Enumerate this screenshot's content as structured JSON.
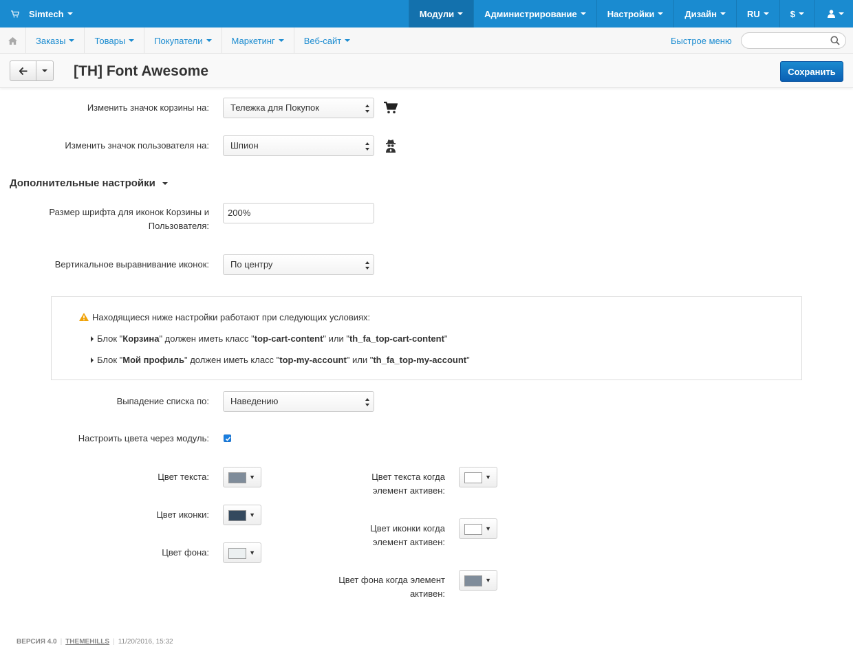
{
  "topbar": {
    "brand": "Simtech",
    "menu": [
      {
        "label": "Модули",
        "active": true
      },
      {
        "label": "Администрирование"
      },
      {
        "label": "Настройки"
      },
      {
        "label": "Дизайн"
      },
      {
        "label": "RU"
      },
      {
        "label": "$"
      },
      {
        "label": ""
      }
    ]
  },
  "subnav": {
    "tabs": [
      "Заказы",
      "Товары",
      "Покупатели",
      "Маркетинг",
      "Веб-сайт"
    ],
    "quick_menu": "Быстрое меню",
    "search_placeholder": ""
  },
  "titlebar": {
    "title": "[TH] Font Awesome",
    "save_label": "Сохранить"
  },
  "form": {
    "cart_icon": {
      "label": "Изменить значок корзины на:",
      "value": "Тележка для Покупок",
      "preview_icon": "shopping-cart-icon"
    },
    "user_icon": {
      "label": "Изменить значок пользователя на:",
      "value": "Шпион",
      "preview_icon": "user-secret-icon"
    },
    "section_title": "Дополнительные настройки",
    "font_size": {
      "label_line1": "Размер шрифта для иконок Корзины и",
      "label_line2": "Пользователя:",
      "value": "200%"
    },
    "vertical_align": {
      "label": "Вертикальное выравнивание иконок:",
      "value": "По центру"
    },
    "notice": {
      "intro": "Находящиеся ниже настройки работают при следующих условиях:",
      "line1": {
        "pre": "Блок \"",
        "block": "Корзина",
        "mid": "\" должен иметь класс \"",
        "cls1": "top-cart-content",
        "or": "\" или \"",
        "cls2": "th_fa_top-cart-content",
        "end": "\""
      },
      "line2": {
        "pre": "Блок \"",
        "block": "Мой профиль",
        "mid": "\" должен иметь класс \"",
        "cls1": "top-my-account",
        "or": "\" или \"",
        "cls2": "th_fa_top-my-account",
        "end": "\""
      }
    },
    "dropdown_on": {
      "label": "Выпадение списка по:",
      "value": "Наведению"
    },
    "colors_via_module": {
      "label": "Настроить цвета через модуль:",
      "checked": true
    },
    "colors": {
      "text": {
        "label": "Цвет текста:",
        "color": "#7f8c9a"
      },
      "icon": {
        "label": "Цвет иконки:",
        "color": "#34495e"
      },
      "bg": {
        "label": "Цвет фона:",
        "color": "#ecf0f1"
      },
      "text_active": {
        "label_line1": "Цвет текста когда",
        "label_line2": "элемент активен:",
        "color": "#ffffff"
      },
      "icon_active": {
        "label_line1": "Цвет иконки когда",
        "label_line2": "элемент активен:",
        "color": "#ffffff"
      },
      "bg_active": {
        "label_line1": "Цвет фона когда элемент",
        "label_line2": "активен:",
        "color": "#7f8c9a"
      }
    }
  },
  "footer": {
    "version": "ВЕРСИЯ 4.0",
    "vendor": "THEMEHILLS",
    "date": "11/20/2016, 15:32"
  }
}
